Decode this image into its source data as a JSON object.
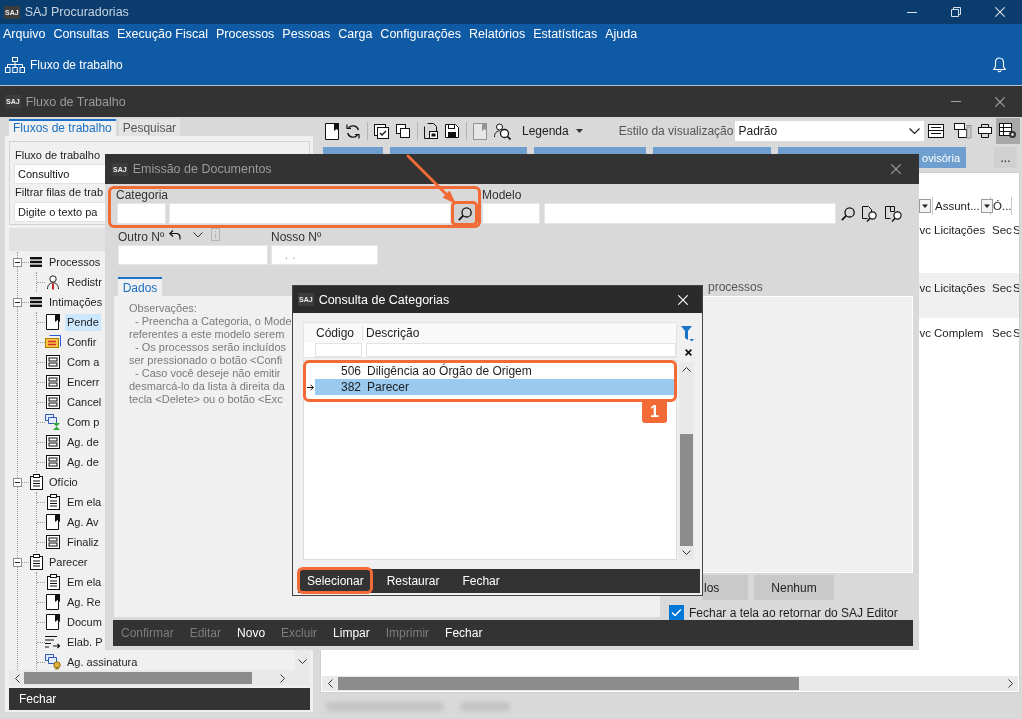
{
  "app": {
    "logo": "SAJ",
    "title": "SAJ Procuradorias"
  },
  "menu": [
    "Arquivo",
    "Consultas",
    "Execução Fiscal",
    "Processos",
    "Pessoas",
    "Carga",
    "Configurações",
    "Relatórios",
    "Estatísticas",
    "Ajuda"
  ],
  "ribbon": {
    "label": "Fluxo de trabalho"
  },
  "workflow_window": {
    "logo": "SAJ",
    "title": "Fluxo de Trabalho"
  },
  "left_panel": {
    "tabs": [
      {
        "label": "Fluxos de trabalho",
        "selected": true
      },
      {
        "label": "Pesquisar",
        "selected": false
      }
    ],
    "workflow_label": "Fluxo de trabalho",
    "workflow_value": "Consultivo",
    "filter_label": "Filtrar filas de trab",
    "filter_placeholder": "Digite o texto pa",
    "tree": [
      {
        "label": "Processos",
        "kind": "stack",
        "expanded": true,
        "selected": false,
        "children": [
          {
            "label": "Redistr",
            "kind": "person",
            "selected": false
          }
        ]
      },
      {
        "label": "Intimações",
        "kind": "stack",
        "expanded": true,
        "selected": false,
        "children": [
          {
            "label": "Pende",
            "kind": "flag",
            "selected": true
          },
          {
            "label": "Confir",
            "kind": "stamp",
            "selected": false
          },
          {
            "label": "Com a",
            "kind": "form",
            "selected": false
          },
          {
            "label": "Encerr",
            "kind": "form",
            "selected": false
          },
          {
            "label": "Cancel",
            "kind": "form",
            "selected": false
          },
          {
            "label": "Com p",
            "kind": "hourglass",
            "selected": false
          },
          {
            "label": "Ag. de",
            "kind": "form",
            "selected": false
          },
          {
            "label": "Ag. de",
            "kind": "form",
            "selected": false
          }
        ]
      },
      {
        "label": "Ofício",
        "kind": "clipboard",
        "expanded": true,
        "selected": false,
        "children": [
          {
            "label": "Em ela",
            "kind": "clipboard",
            "selected": false
          },
          {
            "label": "Ag. Av",
            "kind": "flag",
            "selected": false
          },
          {
            "label": "Finaliz",
            "kind": "form",
            "selected": false
          }
        ]
      },
      {
        "label": "Parecer",
        "kind": "clipboard",
        "expanded": true,
        "selected": false,
        "children": [
          {
            "label": "Em ela",
            "kind": "clipboard",
            "selected": false
          },
          {
            "label": "Ag. Re",
            "kind": "flag",
            "selected": false
          },
          {
            "label": "Docum",
            "kind": "flag",
            "selected": false
          },
          {
            "label": "Elab. P",
            "kind": "sort",
            "selected": false
          },
          {
            "label": "Ag. assinatura",
            "kind": "seal",
            "selected": false
          }
        ]
      }
    ],
    "close_button": "Fechar"
  },
  "right_panel": {
    "tools": [
      {
        "kind": "document",
        "disabled": false
      },
      {
        "kind": "refresh",
        "disabled": false
      },
      {
        "kind": "separator"
      },
      {
        "kind": "checklist",
        "disabled": false
      },
      {
        "kind": "copy",
        "disabled": false
      },
      {
        "kind": "separator"
      },
      {
        "kind": "export",
        "disabled": false
      },
      {
        "kind": "save",
        "disabled": false
      },
      {
        "kind": "separator"
      },
      {
        "kind": "document",
        "disabled": true
      },
      {
        "kind": "inspect",
        "disabled": false
      }
    ],
    "legend": "Legenda",
    "view_style_label": "Estilo da visualização",
    "view_style": "Padrão",
    "view_tools": [
      {
        "kind": "panes",
        "selected": false
      },
      {
        "kind": "panes-trash",
        "selected": false
      },
      {
        "kind": "stack",
        "selected": false
      },
      {
        "kind": "grid-gear",
        "selected": true
      }
    ],
    "action_buttons": [
      {
        "kind": "blank"
      },
      {
        "kind": "blank"
      },
      {
        "kind": "blank"
      },
      {
        "kind": "blank"
      },
      {
        "kind": "labeled",
        "label": "ovisória"
      }
    ],
    "more_button": "...",
    "table": {
      "columns": [
        {
          "kind": "cut",
          "filter": true
        },
        {
          "kind": "named",
          "label": "Assunt...",
          "filter": true
        },
        {
          "kind": "named",
          "label": "Ó...",
          "filter": false
        }
      ],
      "rows": [
        {
          "cells": [
            "vc",
            "Licitações",
            "Sec",
            "S"
          ]
        },
        {
          "cells": [
            "vc",
            "Licitações",
            "Sec",
            "S"
          ]
        },
        {
          "cells": [
            "vc",
            "Complem",
            "Sec",
            "S"
          ]
        }
      ]
    }
  },
  "emission_dialog": {
    "logo": "SAJ",
    "title": "Emissão de Documentos",
    "category": {
      "label": "Categoria",
      "highlighted": true,
      "search_highlighted": true
    },
    "model": {
      "label": "Modelo"
    },
    "other_number": {
      "label": "Outro Nº"
    },
    "our_number": {
      "label": "Nosso Nº",
      "value": ". ."
    },
    "tabs": [
      {
        "label": "Dados",
        "selected": true
      }
    ],
    "observations": {
      "title": "Observações:",
      "items": [
        {
          "lines": [
            "- Preencha a Categoria, o Mode",
            "referentes a este modelo serem"
          ]
        },
        {
          "lines": [
            "- Os processos serão incluídos",
            "ser pressionado o botão <Confi"
          ]
        },
        {
          "lines": [
            "- Caso você deseje não emitir",
            "desmarcá-lo da lista à direita da",
            "tecla <Delete> ou o botão <Exc"
          ]
        }
      ]
    },
    "processes_label": "processos",
    "list_buttons": [
      "los",
      "Nenhum"
    ],
    "close_option": {
      "label": "Fechar a tela ao retornar do SAJ Editor",
      "checked": true
    },
    "actions": [
      {
        "label": "Confirmar",
        "disabled": true
      },
      {
        "label": "Editar",
        "disabled": true
      },
      {
        "label": "Novo",
        "disabled": false
      },
      {
        "label": "Excluir",
        "disabled": true
      },
      {
        "label": "Limpar",
        "disabled": false
      },
      {
        "label": "Imprimir",
        "disabled": true
      },
      {
        "label": "Fechar",
        "disabled": false
      }
    ]
  },
  "lookup_dialog": {
    "logo": "SAJ",
    "title": "Consulta de Categorias",
    "columns": [
      "Código",
      "Descrição"
    ],
    "rows": [
      {
        "code": "506",
        "description": "Diligência ao Órgão de Origem",
        "selected": false
      },
      {
        "code": "382",
        "description": "Parecer",
        "selected": true
      }
    ],
    "rows_highlighted": true,
    "step_label": "1",
    "buttons": [
      {
        "label": "Selecionar",
        "highlighted": true
      },
      {
        "label": "Restaurar",
        "highlighted": false
      },
      {
        "label": "Fechar",
        "highlighted": false
      }
    ]
  },
  "annotations": {
    "pointer_arrow": true
  }
}
